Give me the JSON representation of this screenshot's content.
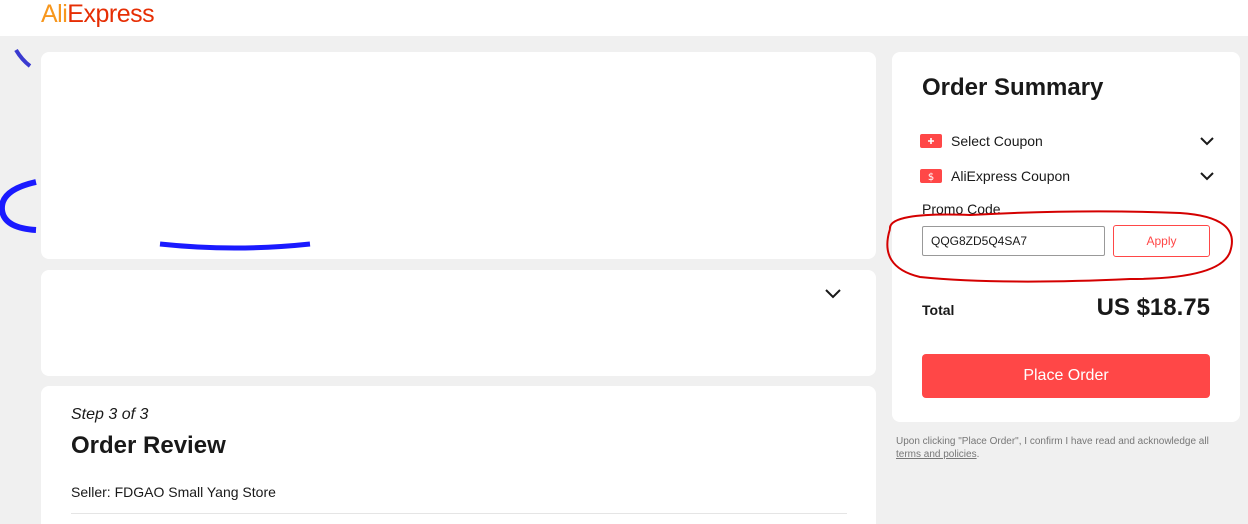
{
  "brand": {
    "part1": "Ali",
    "part2": "Express"
  },
  "payment": {
    "chevron_icon": "chevron-down-icon"
  },
  "review": {
    "step": "Step 3 of 3",
    "title": "Order Review",
    "seller": "Seller: FDGAO Small Yang Store"
  },
  "summary": {
    "title": "Order Summary",
    "select_coupon": "Select Coupon",
    "aliexpress_coupon": "AliExpress Coupon",
    "promo_label": "Promo Code",
    "promo_value": "QQG8ZD5Q4SA7",
    "apply": "Apply",
    "total_label": "Total",
    "total_value": "US $18.75",
    "place_order": "Place Order"
  },
  "disclaimer": {
    "text": "Upon clicking \"Place Order\", I confirm I have read and acknowledge all",
    "link": "terms and policies",
    "end": "."
  },
  "colors": {
    "accent": "#ff4747",
    "logo_orange": "#f7971e",
    "logo_red": "#e62e04",
    "annotation_blue": "#1a1aff",
    "annotation_red": "#d40000"
  }
}
